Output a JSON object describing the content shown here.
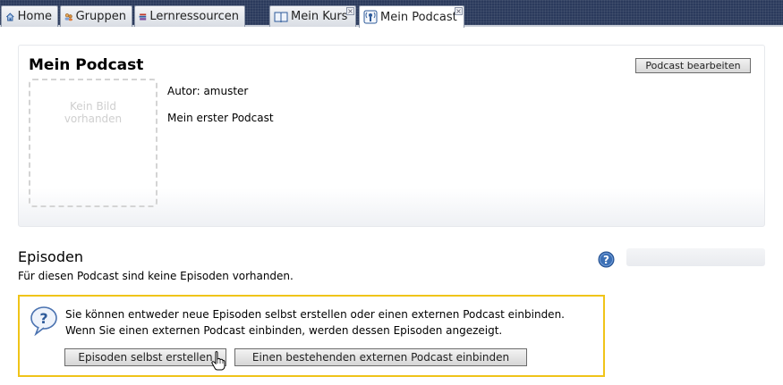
{
  "tabs": [
    {
      "label": "Home",
      "icon": "home-icon"
    },
    {
      "label": "Gruppen",
      "icon": "groups-icon"
    },
    {
      "label": "Lernressourcen",
      "icon": "books-icon"
    },
    {
      "label": "Mein Kurs",
      "icon": "course-book-icon"
    },
    {
      "label": "Mein Podcast",
      "icon": "podcast-icon",
      "active": true
    }
  ],
  "podcast": {
    "title": "Mein Podcast",
    "edit_label": "Podcast bearbeiten",
    "no_image_line1": "Kein Bild",
    "no_image_line2": "vorhanden",
    "author": "Autor: amuster",
    "description": "Mein erster Podcast"
  },
  "episodes": {
    "title": "Episoden",
    "empty_text": "Für diesen Podcast sind keine Episoden vorhanden.",
    "info_line1": "Sie können entweder neue Episoden selbst erstellen oder einen externen Podcast einbinden.",
    "info_line2": "Wenn Sie einen externen Podcast einbinden, werden dessen Episoden angezeigt.",
    "create_label": "Episoden selbst erstellen",
    "embed_label": "Einen bestehenden externen Podcast einbinden"
  },
  "colors": {
    "tabbar_bg": "#2b3a5c",
    "info_border": "#f0c419",
    "help_icon": "#3b6fb5"
  }
}
